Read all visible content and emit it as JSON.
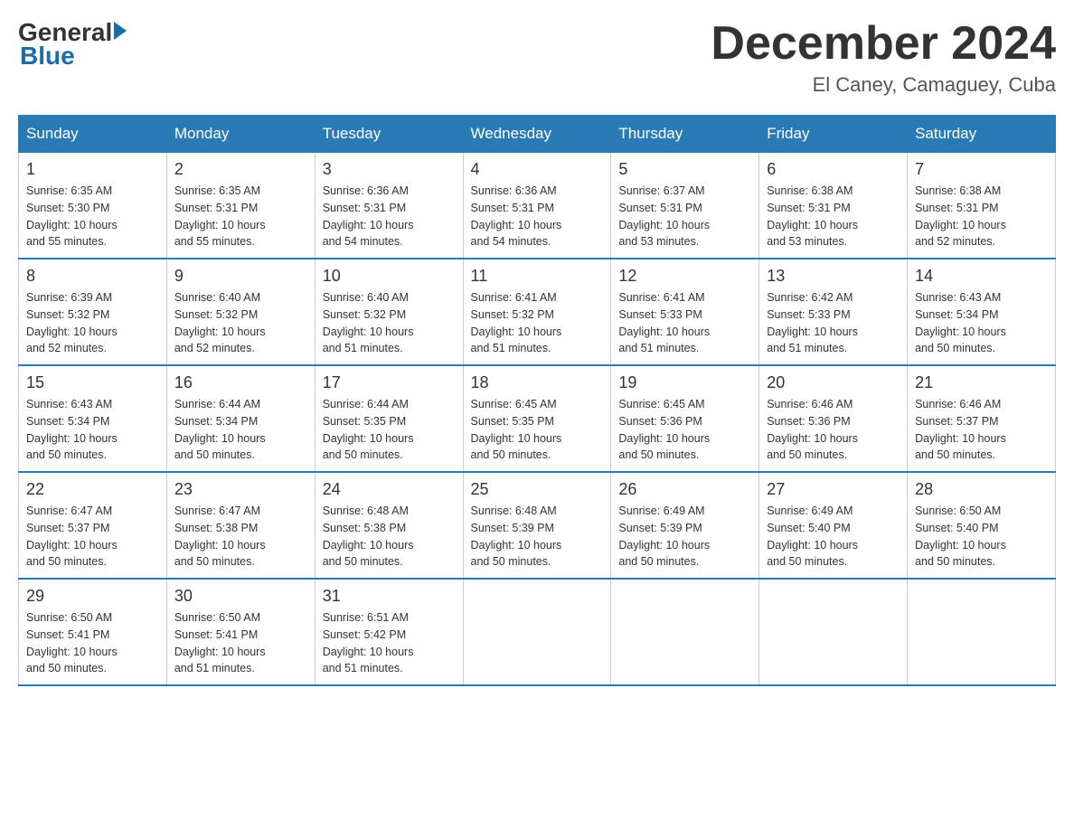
{
  "header": {
    "logo_general": "General",
    "logo_blue": "Blue",
    "title": "December 2024",
    "subtitle": "El Caney, Camaguey, Cuba"
  },
  "weekdays": [
    "Sunday",
    "Monday",
    "Tuesday",
    "Wednesday",
    "Thursday",
    "Friday",
    "Saturday"
  ],
  "weeks": [
    [
      {
        "day": "1",
        "sunrise": "6:35 AM",
        "sunset": "5:30 PM",
        "daylight": "10 hours and 55 minutes."
      },
      {
        "day": "2",
        "sunrise": "6:35 AM",
        "sunset": "5:31 PM",
        "daylight": "10 hours and 55 minutes."
      },
      {
        "day": "3",
        "sunrise": "6:36 AM",
        "sunset": "5:31 PM",
        "daylight": "10 hours and 54 minutes."
      },
      {
        "day": "4",
        "sunrise": "6:36 AM",
        "sunset": "5:31 PM",
        "daylight": "10 hours and 54 minutes."
      },
      {
        "day": "5",
        "sunrise": "6:37 AM",
        "sunset": "5:31 PM",
        "daylight": "10 hours and 53 minutes."
      },
      {
        "day": "6",
        "sunrise": "6:38 AM",
        "sunset": "5:31 PM",
        "daylight": "10 hours and 53 minutes."
      },
      {
        "day": "7",
        "sunrise": "6:38 AM",
        "sunset": "5:31 PM",
        "daylight": "10 hours and 52 minutes."
      }
    ],
    [
      {
        "day": "8",
        "sunrise": "6:39 AM",
        "sunset": "5:32 PM",
        "daylight": "10 hours and 52 minutes."
      },
      {
        "day": "9",
        "sunrise": "6:40 AM",
        "sunset": "5:32 PM",
        "daylight": "10 hours and 52 minutes."
      },
      {
        "day": "10",
        "sunrise": "6:40 AM",
        "sunset": "5:32 PM",
        "daylight": "10 hours and 51 minutes."
      },
      {
        "day": "11",
        "sunrise": "6:41 AM",
        "sunset": "5:32 PM",
        "daylight": "10 hours and 51 minutes."
      },
      {
        "day": "12",
        "sunrise": "6:41 AM",
        "sunset": "5:33 PM",
        "daylight": "10 hours and 51 minutes."
      },
      {
        "day": "13",
        "sunrise": "6:42 AM",
        "sunset": "5:33 PM",
        "daylight": "10 hours and 51 minutes."
      },
      {
        "day": "14",
        "sunrise": "6:43 AM",
        "sunset": "5:34 PM",
        "daylight": "10 hours and 50 minutes."
      }
    ],
    [
      {
        "day": "15",
        "sunrise": "6:43 AM",
        "sunset": "5:34 PM",
        "daylight": "10 hours and 50 minutes."
      },
      {
        "day": "16",
        "sunrise": "6:44 AM",
        "sunset": "5:34 PM",
        "daylight": "10 hours and 50 minutes."
      },
      {
        "day": "17",
        "sunrise": "6:44 AM",
        "sunset": "5:35 PM",
        "daylight": "10 hours and 50 minutes."
      },
      {
        "day": "18",
        "sunrise": "6:45 AM",
        "sunset": "5:35 PM",
        "daylight": "10 hours and 50 minutes."
      },
      {
        "day": "19",
        "sunrise": "6:45 AM",
        "sunset": "5:36 PM",
        "daylight": "10 hours and 50 minutes."
      },
      {
        "day": "20",
        "sunrise": "6:46 AM",
        "sunset": "5:36 PM",
        "daylight": "10 hours and 50 minutes."
      },
      {
        "day": "21",
        "sunrise": "6:46 AM",
        "sunset": "5:37 PM",
        "daylight": "10 hours and 50 minutes."
      }
    ],
    [
      {
        "day": "22",
        "sunrise": "6:47 AM",
        "sunset": "5:37 PM",
        "daylight": "10 hours and 50 minutes."
      },
      {
        "day": "23",
        "sunrise": "6:47 AM",
        "sunset": "5:38 PM",
        "daylight": "10 hours and 50 minutes."
      },
      {
        "day": "24",
        "sunrise": "6:48 AM",
        "sunset": "5:38 PM",
        "daylight": "10 hours and 50 minutes."
      },
      {
        "day": "25",
        "sunrise": "6:48 AM",
        "sunset": "5:39 PM",
        "daylight": "10 hours and 50 minutes."
      },
      {
        "day": "26",
        "sunrise": "6:49 AM",
        "sunset": "5:39 PM",
        "daylight": "10 hours and 50 minutes."
      },
      {
        "day": "27",
        "sunrise": "6:49 AM",
        "sunset": "5:40 PM",
        "daylight": "10 hours and 50 minutes."
      },
      {
        "day": "28",
        "sunrise": "6:50 AM",
        "sunset": "5:40 PM",
        "daylight": "10 hours and 50 minutes."
      }
    ],
    [
      {
        "day": "29",
        "sunrise": "6:50 AM",
        "sunset": "5:41 PM",
        "daylight": "10 hours and 50 minutes."
      },
      {
        "day": "30",
        "sunrise": "6:50 AM",
        "sunset": "5:41 PM",
        "daylight": "10 hours and 51 minutes."
      },
      {
        "day": "31",
        "sunrise": "6:51 AM",
        "sunset": "5:42 PM",
        "daylight": "10 hours and 51 minutes."
      },
      null,
      null,
      null,
      null
    ]
  ],
  "labels": {
    "sunrise": "Sunrise:",
    "sunset": "Sunset:",
    "daylight": "Daylight:"
  }
}
